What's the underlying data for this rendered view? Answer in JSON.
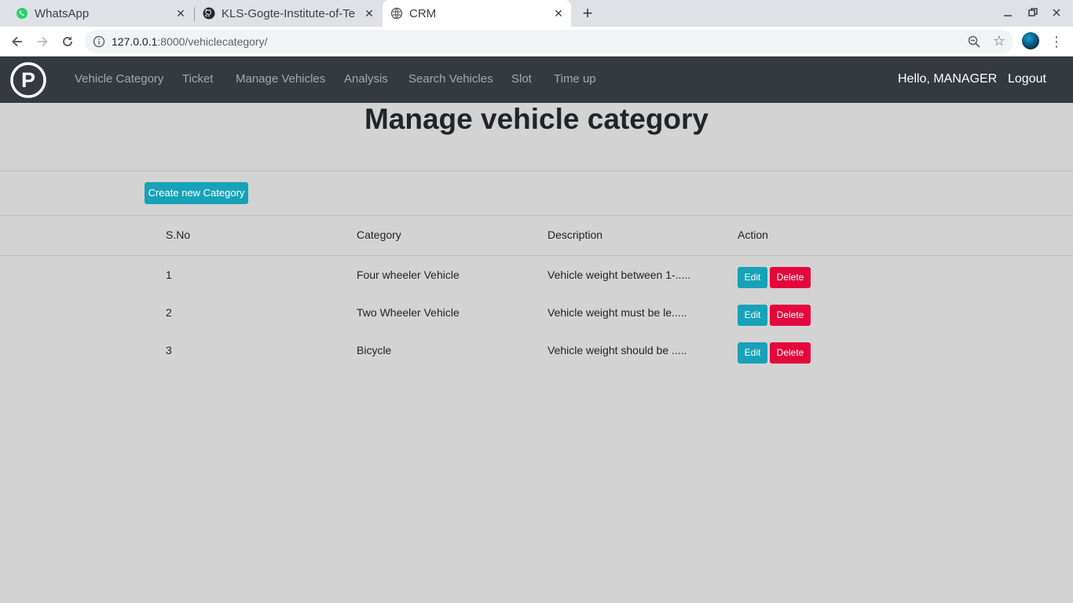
{
  "browser": {
    "tabs": [
      {
        "title": "WhatsApp",
        "icon": "whatsapp-icon"
      },
      {
        "title": "KLS-Gogte-Institute-of-Te",
        "icon": "github-icon"
      },
      {
        "title": "CRM",
        "icon": "globe-icon"
      }
    ],
    "url_host": "127.0.0.1",
    "url_path": ":8000/vehiclecategory/"
  },
  "navbar": {
    "links": [
      "Vehicle Category",
      "Ticket",
      "Manage Vehicles",
      "Analysis",
      "Search Vehicles",
      "Slot",
      "Time up"
    ],
    "greeting": "Hello, MANAGER",
    "logout": "Logout",
    "brand_letter": "P"
  },
  "page": {
    "title": "Manage vehicle category",
    "create_button": "Create new Category"
  },
  "table": {
    "headers": [
      "S.No",
      "Category",
      "Description",
      "Action"
    ],
    "rows": [
      {
        "sno": "1",
        "category": "Four wheeler Vehicle",
        "description": "Vehicle weight between 1-.....",
        "edit": "Edit",
        "delete": "Delete"
      },
      {
        "sno": "2",
        "category": "Two Wheeler Vehicle",
        "description": "Vehicle weight must be le.....",
        "edit": "Edit",
        "delete": "Delete"
      },
      {
        "sno": "3",
        "category": "Bicycle",
        "description": "Vehicle weight should be .....",
        "edit": "Edit",
        "delete": "Delete"
      }
    ]
  },
  "colors": {
    "navbar": "#343a40",
    "background": "#d3d3d3",
    "info": "#17a2b8",
    "danger": "#e4073b"
  }
}
